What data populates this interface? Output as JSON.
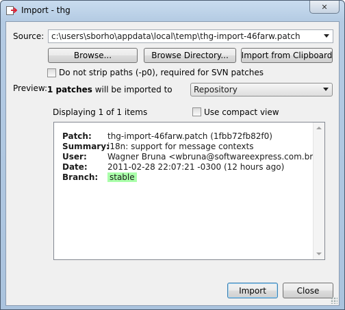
{
  "window": {
    "title": "Import - thg",
    "close_glyph": "✕"
  },
  "source": {
    "label": "Source:",
    "value": "c:\\users\\sborho\\appdata\\local\\temp\\thg-import-46farw.patch"
  },
  "buttons": {
    "browse": "Browse...",
    "browse_directory": "Browse Directory...",
    "import_clipboard": "Import from Clipboard",
    "import": "Import",
    "close": "Close"
  },
  "options": {
    "no_strip_label": "Do not strip paths (-p0), required for SVN patches",
    "no_strip_checked": false,
    "compact_label": "Use compact view",
    "compact_checked": false
  },
  "preview": {
    "label": "Preview:",
    "count_bold": "1 patches",
    "count_rest": "will be imported to",
    "target": "Repository",
    "displaying": "Displaying 1 of 1 items"
  },
  "patch": {
    "patch_key": "Patch:",
    "patch_val": "thg-import-46farw.patch (1fbb72fb82f0)",
    "summary_key": "Summary:",
    "summary_val": "i18n: support for message contexts",
    "user_key": "User:",
    "user_val": "Wagner Bruna <wbruna@softwareexpress.com.br>",
    "date_key": "Date:",
    "date_val": "2011-02-28 22:07:21 -0300 (12 hours ago)",
    "branch_key": "Branch:",
    "branch_val": "stable"
  },
  "colors": {
    "branch_highlight": "#aaffaa",
    "default_button_border": "#3c7fb1"
  }
}
